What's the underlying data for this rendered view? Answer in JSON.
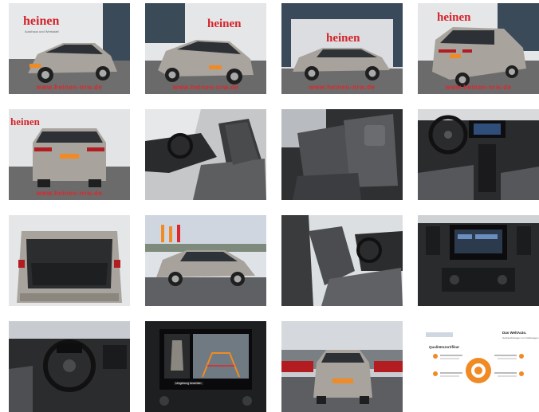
{
  "gallery": {
    "watermark_url": "www.heinen-nrw.de",
    "dealer_logo": "heinen",
    "dealer_logo_sub": "Autohaus und Werkstatt",
    "certificate": {
      "title": "Qualitätszertifikat",
      "brand": "Das WeltAuto.",
      "brand_sub": "Gebrauchtwagen von Volkswagen"
    },
    "camera_warning": "Umgebung beachten",
    "colors": {
      "accent_red": "#e0262b",
      "certificate_orange": "#f08a24"
    }
  }
}
